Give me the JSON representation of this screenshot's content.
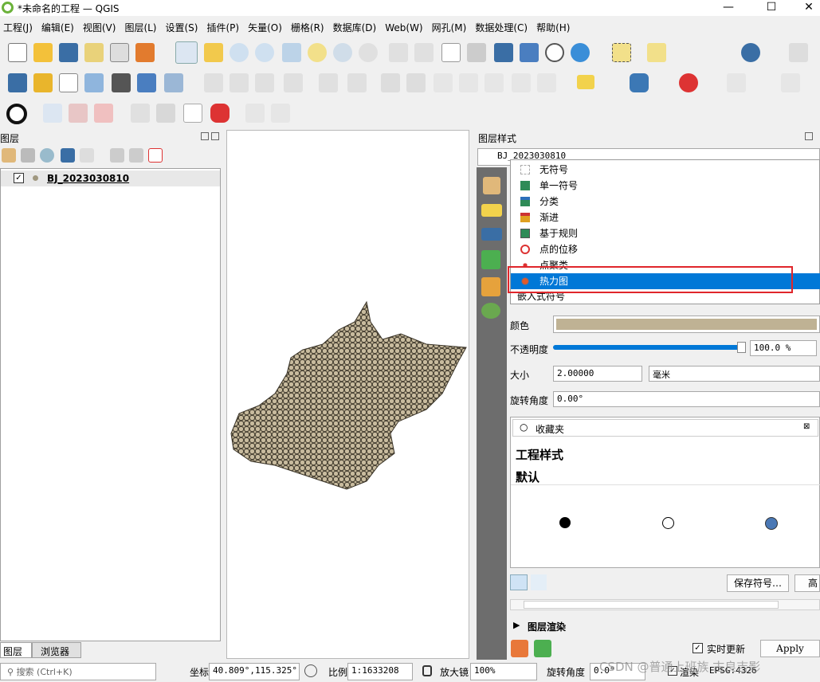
{
  "window": {
    "title": "*未命名的工程 — QGIS",
    "minimize": "—",
    "maximize": "☐",
    "close": "✕"
  },
  "menu": [
    "工程(J)",
    "编辑(E)",
    "视图(V)",
    "图层(L)",
    "设置(S)",
    "插件(P)",
    "矢量(O)",
    "栅格(R)",
    "数据库(D)",
    "Web(W)",
    "网孔(M)",
    "数据处理(C)",
    "帮助(H)"
  ],
  "layers_panel": {
    "title": "图层",
    "layer_name": "BJ_2023030810",
    "checked": true
  },
  "bottom_tabs": [
    "图层",
    "浏览器"
  ],
  "style_panel": {
    "title": "图层样式",
    "layer_select": "BJ_2023030810",
    "renderer_options": [
      "无符号",
      "单一符号",
      "分类",
      "渐进",
      "基于规则",
      "点的位移",
      "点聚类",
      "热力图"
    ],
    "selected_renderer": "热力图",
    "embedded_label": "嵌入式符号",
    "color_label": "颜色",
    "symbol_color": "#bfb294",
    "opacity_label": "不透明度",
    "opacity_value": "100.0 %",
    "opacity_fraction": 1.0,
    "size_label": "大小",
    "size_value": "2.00000",
    "size_unit": "毫米",
    "rotation_label": "旋转角度",
    "rotation_value": "0.00°",
    "search_placeholder": "收藏夹",
    "project_styles": "工程样式",
    "default_label": "默认",
    "save_symbol": "保存符号…",
    "advanced": "高",
    "rendering_label": "图层渲染",
    "live_update": "实时更新",
    "apply": "Apply"
  },
  "status": {
    "search_placeholder": "搜索 (Ctrl+K)",
    "coord_label": "坐标",
    "coord_value": "40.809°,115.325°",
    "scale_label": "比例",
    "scale_value": "1:1633208",
    "magnifier_label": "放大镜",
    "magnifier_value": "100%",
    "rotation_label": "旋转角度",
    "rotation_value": "0.0°",
    "render_label": "渲染",
    "crs_value": "EPSG:4326",
    "watermark": "CSDN @普通上班族 古良吉影"
  },
  "colors": {
    "accent": "#0078d7",
    "highlight_box": "#e0262b",
    "symbol_fill": "#bfb294"
  }
}
